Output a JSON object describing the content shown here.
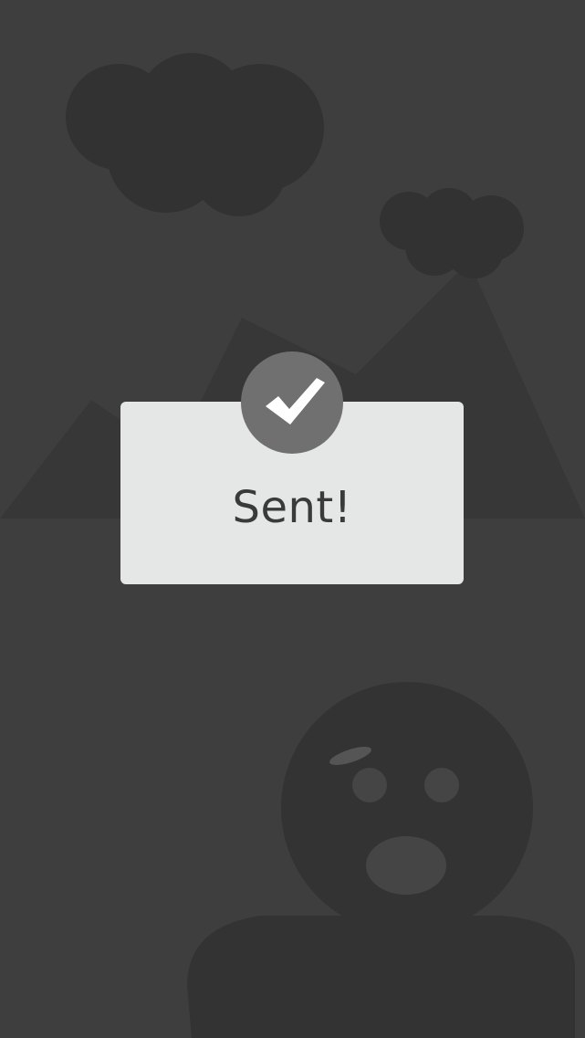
{
  "toast": {
    "message": "Sent!",
    "icon": "checkmark-icon",
    "card_color": "#e5e7e6",
    "badge_color": "#707070"
  },
  "background": {
    "color": "#3e3e3e",
    "illustration_color": "#333333",
    "illustration": [
      "cloud-icon",
      "cloud-icon",
      "mountain-icon",
      "surprised-face-icon"
    ]
  }
}
